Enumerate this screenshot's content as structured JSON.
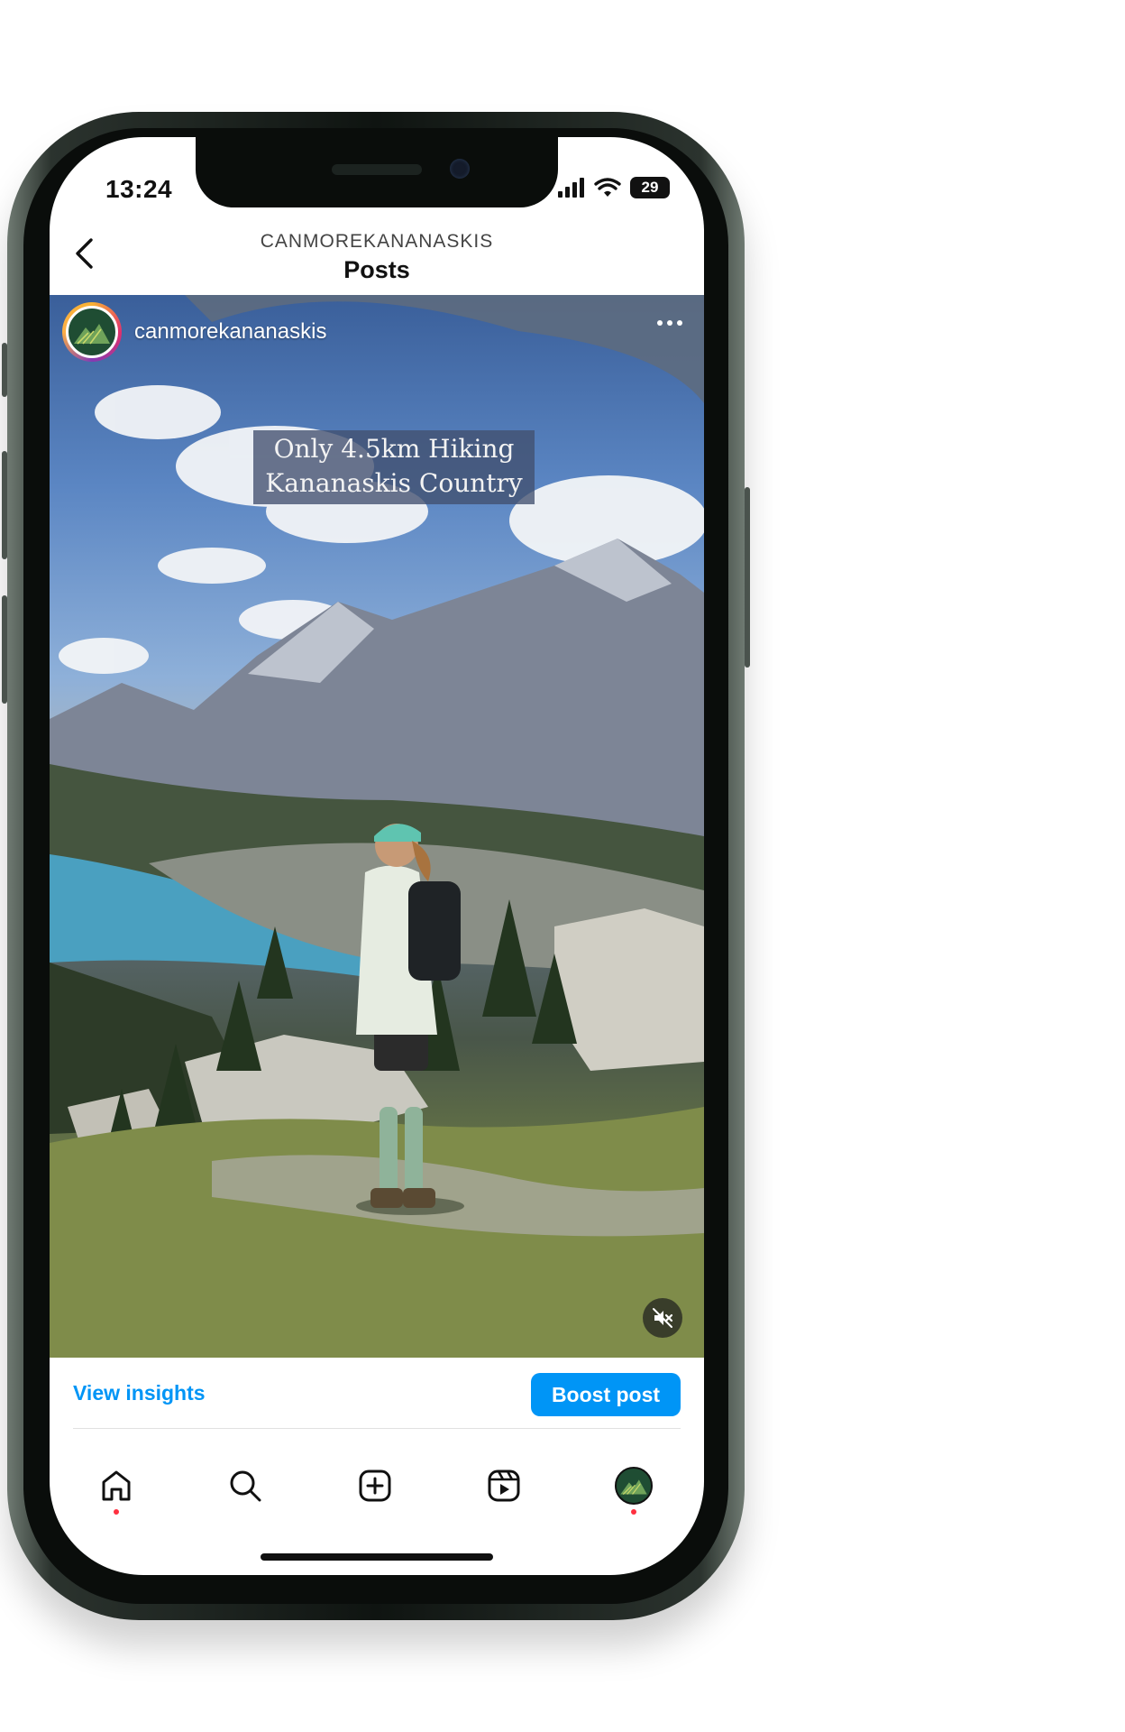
{
  "status_bar": {
    "time": "13:24",
    "battery": "29"
  },
  "header": {
    "account_handle": "CANMOREKANANASKIS",
    "title": "Posts"
  },
  "post": {
    "username": "canmorekananaskis",
    "caption_line1": "Only 4.5km Hiking",
    "caption_line2": "Kananaskis Country"
  },
  "actions": {
    "insights_label": "View insights",
    "boost_label": "Boost post"
  },
  "nav": [
    "home-icon",
    "search-icon",
    "create-icon",
    "reels-icon",
    "profile-icon"
  ],
  "colors": {
    "accent": "#0095f6",
    "notification_dot": "#ff3040"
  }
}
